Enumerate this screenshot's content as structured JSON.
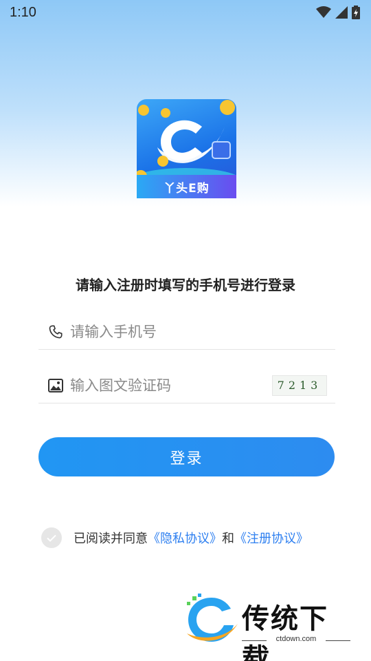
{
  "status_bar": {
    "time": "1:10"
  },
  "logo": {
    "banner_text": "丫头E购"
  },
  "login": {
    "prompt": "请输入注册时填写的手机号进行登录",
    "phone_placeholder": "请输入手机号",
    "captcha_placeholder": "输入图文验证码",
    "captcha_text": "7213",
    "login_button": "登录"
  },
  "agreement": {
    "prefix": "已阅读并同意",
    "privacy_link": "《隐私协议》",
    "and": "和",
    "register_link": "《注册协议》"
  },
  "watermark": {
    "title": "传统下载",
    "url": "ctdown.com"
  },
  "colors": {
    "accent": "#2196f3",
    "link": "#2d7ff0"
  }
}
